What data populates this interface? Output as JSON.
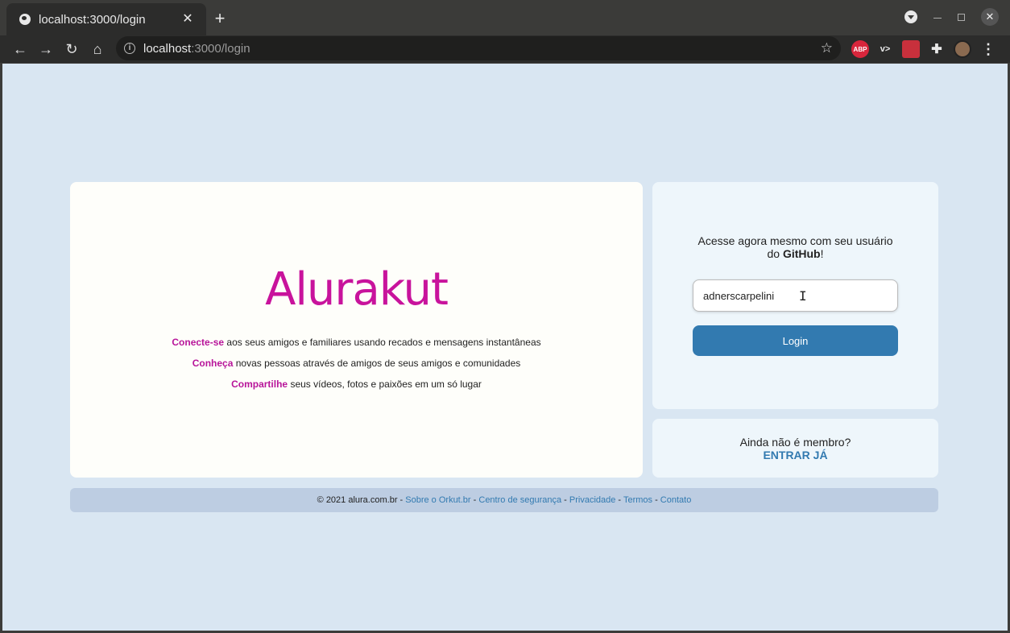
{
  "browser": {
    "tab_title": "localhost:3000/login",
    "url_host": "localhost",
    "url_path": ":3000/login",
    "extensions": [
      "ABP",
      "v>",
      "red-ext",
      "puzzle",
      "avatar"
    ]
  },
  "main": {
    "logo": "Alurakut",
    "features": [
      {
        "highlight": "Conecte-se",
        "text": " aos seus amigos e familiares usando recados e mensagens instantâneas"
      },
      {
        "highlight": "Conheça",
        "text": " novas pessoas através de amigos de seus amigos e comunidades"
      },
      {
        "highlight": "Compartilhe",
        "text": " seus vídeos, fotos e paixões em um só lugar"
      }
    ]
  },
  "login": {
    "prompt_line1": "Acesse agora mesmo com seu usuário",
    "prompt_do": "do ",
    "prompt_bold": "GitHub",
    "prompt_end": "!",
    "username_value": "adnerscarpelini",
    "button_label": "Login"
  },
  "signup": {
    "question": "Ainda não é membro?",
    "link_label": "ENTRAR JÁ"
  },
  "footer": {
    "copyright": "© 2021 alura.com.br",
    "sep": " - ",
    "links": [
      "Sobre o Orkut.br",
      "Centro de segurança",
      "Privacidade",
      "Termos",
      "Contato"
    ]
  },
  "colors": {
    "brand": "#c8139c",
    "accent": "#327ab0",
    "background": "#d9e6f2"
  }
}
